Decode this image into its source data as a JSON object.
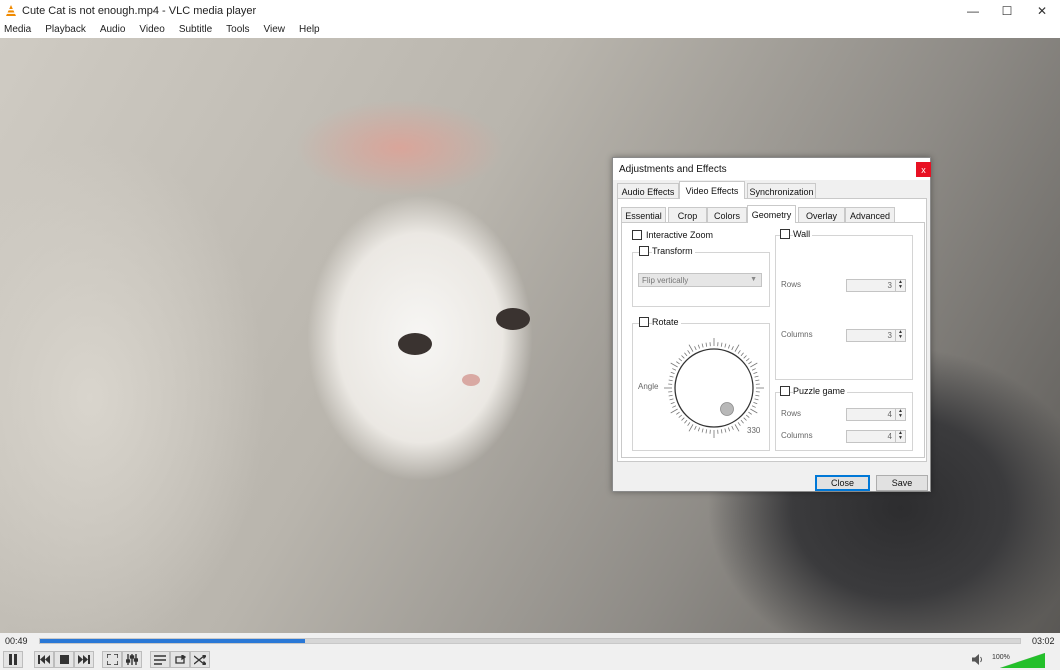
{
  "window": {
    "title": "Cute Cat is not enough.mp4 - VLC media player",
    "controls": {
      "minimize": "—",
      "maximize": "☐",
      "close": "✕"
    }
  },
  "menubar": [
    "Media",
    "Playback",
    "Audio",
    "Video",
    "Subtitle",
    "Tools",
    "View",
    "Help"
  ],
  "player": {
    "elapsed": "00:49",
    "total": "03:02",
    "progress_fraction": 0.27,
    "volume_label": "100%",
    "volume_fraction": 1.0
  },
  "dialog": {
    "title": "Adjustments and Effects",
    "close_glyph": "x",
    "main_tabs": [
      "Audio Effects",
      "Video Effects",
      "Synchronization"
    ],
    "active_main_tab": "Video Effects",
    "sub_tabs": [
      "Essential",
      "Crop",
      "Colors",
      "Geometry",
      "Overlay",
      "Advanced"
    ],
    "active_sub_tab": "Geometry",
    "interactive_zoom": {
      "label": "Interactive Zoom",
      "checked": false
    },
    "transform": {
      "label": "Transform",
      "checked": false,
      "selected": "Flip vertically"
    },
    "rotate": {
      "label": "Rotate",
      "checked": false,
      "angle_label": "Angle",
      "angle_value": "330"
    },
    "wall": {
      "label": "Wall",
      "checked": false,
      "rows_label": "Rows",
      "rows_value": "3",
      "columns_label": "Columns",
      "columns_value": "3"
    },
    "puzzle": {
      "label": "Puzzle game",
      "checked": false,
      "rows_label": "Rows",
      "rows_value": "4",
      "columns_label": "Columns",
      "columns_value": "4"
    },
    "buttons": {
      "close": "Close",
      "save": "Save"
    }
  },
  "colors": {
    "accent": "#2a78d6",
    "close_red": "#e81123",
    "vlc_orange": "#f08a00"
  }
}
